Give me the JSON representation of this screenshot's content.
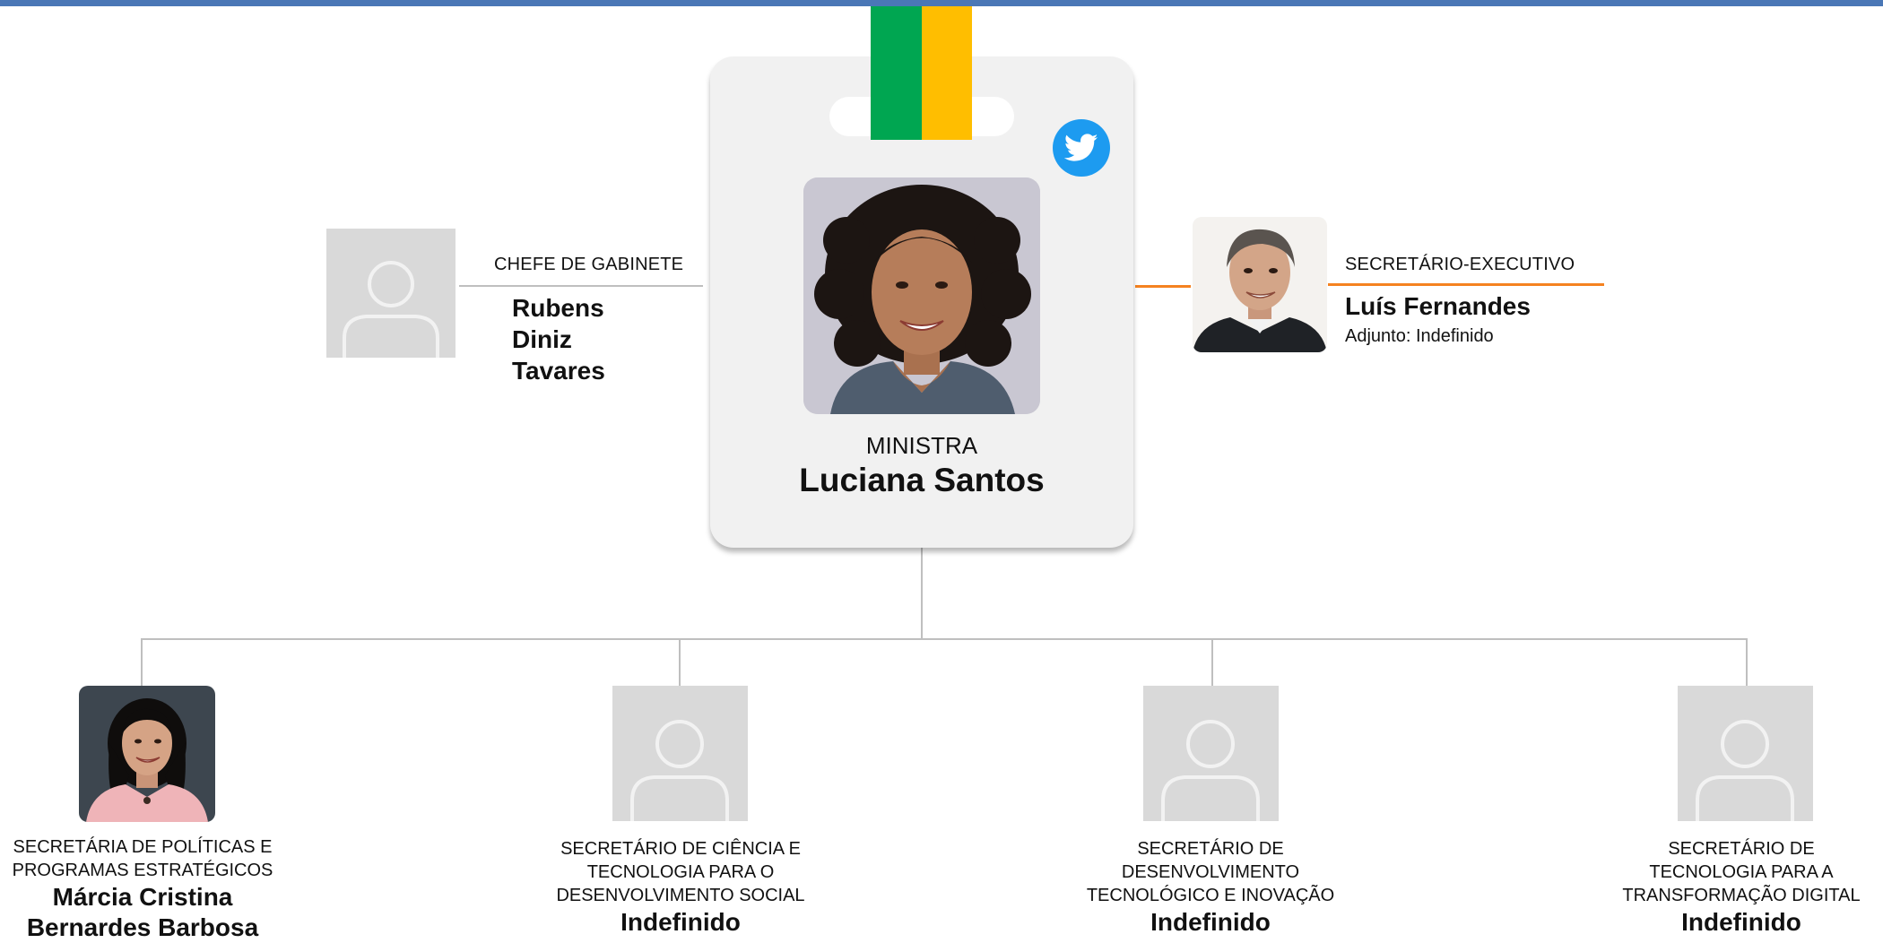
{
  "colors": {
    "top_bar": "#4a77b6",
    "lanyard_green": "#00a651",
    "lanyard_yellow": "#ffbe00",
    "twitter_blue": "#1d9bf0",
    "orange_line": "#f58220",
    "gray_line": "#bfbfbf",
    "placeholder_bg": "#d9d9d9",
    "placeholder_fg": "#f2f2f2"
  },
  "minister": {
    "role": "MINISTRA",
    "name": "Luciana Santos",
    "social_icon": "twitter-icon"
  },
  "chief_of_staff": {
    "role": "CHEFE DE GABINETE",
    "name_lines": [
      "Rubens",
      "Diniz",
      "Tavares"
    ]
  },
  "executive_secretary": {
    "role": "SECRETÁRIO-EXECUTIVO",
    "name": "Luís Fernandes",
    "deputy": "Adjunto: Indefinido"
  },
  "secretaries": [
    {
      "role_lines": [
        "SECRETÁRIA DE POLÍTICAS E",
        "PROGRAMAS ESTRATÉGICOS"
      ],
      "name_lines": [
        "Márcia Cristina",
        "Bernardes Barbosa"
      ],
      "has_photo": true
    },
    {
      "role_lines": [
        "SECRETÁRIO DE CIÊNCIA E",
        "TECNOLOGIA PARA O",
        "DESENVOLVIMENTO SOCIAL"
      ],
      "name_lines": [
        "Indefinido"
      ],
      "has_photo": false
    },
    {
      "role_lines": [
        "SECRETÁRIO DE",
        "DESENVOLVIMENTO",
        "TECNOLÓGICO E INOVAÇÃO"
      ],
      "name_lines": [
        "Indefinido"
      ],
      "has_photo": false
    },
    {
      "role_lines": [
        "SECRETÁRIO DE",
        "TECNOLOGIA PARA A",
        "TRANSFORMAÇÃO DIGITAL"
      ],
      "name_lines": [
        "Indefinido"
      ],
      "has_photo": false
    }
  ]
}
